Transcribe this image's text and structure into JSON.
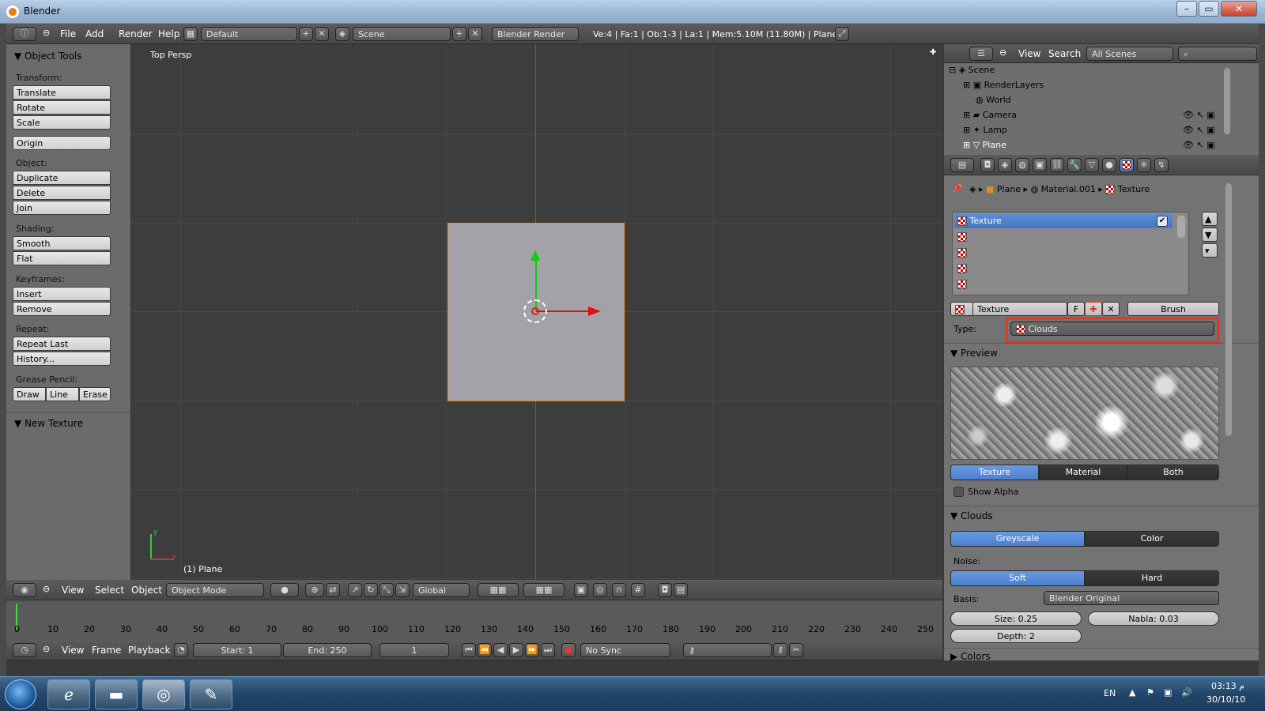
{
  "window": {
    "title": "Blender"
  },
  "topbar": {
    "menus": [
      "File",
      "Add",
      "Render",
      "Help"
    ],
    "layout": "Default",
    "scene": "Scene",
    "engine": "Blender Render",
    "stats": "Ve:4 | Fa:1 | Ob:1-3 | La:1 | Mem:5.10M (11.80M) | Plane"
  },
  "tools": {
    "title": "Object Tools",
    "transform_label": "Transform:",
    "translate": "Translate",
    "rotate": "Rotate",
    "scale": "Scale",
    "origin": "Origin",
    "object_label": "Object:",
    "duplicate": "Duplicate",
    "delete": "Delete",
    "join": "Join",
    "shading_label": "Shading:",
    "smooth": "Smooth",
    "flat": "Flat",
    "keyframes_label": "Keyframes:",
    "insert": "Insert",
    "remove": "Remove",
    "repeat_label": "Repeat:",
    "repeat_last": "Repeat Last",
    "history": "History...",
    "grease_label": "Grease Pencil:",
    "draw": "Draw",
    "line": "Line",
    "erase": "Erase",
    "new_texture": "New Texture"
  },
  "viewport": {
    "view_name": "Top Persp",
    "object_label": "(1) Plane",
    "axis_x": "x",
    "axis_y": "y"
  },
  "view_header": {
    "view": "View",
    "select": "Select",
    "object": "Object",
    "mode": "Object Mode",
    "orientation": "Global"
  },
  "timeline": {
    "ticks": [
      "0",
      "10",
      "20",
      "30",
      "40",
      "50",
      "60",
      "70",
      "80",
      "90",
      "100",
      "110",
      "120",
      "130",
      "140",
      "150",
      "160",
      "170",
      "180",
      "190",
      "200",
      "210",
      "220",
      "230",
      "240",
      "250"
    ],
    "view": "View",
    "frame": "Frame",
    "playback": "Playback",
    "start": "Start: 1",
    "end": "End: 250",
    "current": "1",
    "sync": "No Sync"
  },
  "outliner": {
    "view": "View",
    "search": "Search",
    "scenes": "All Scenes",
    "items": [
      "Scene",
      "RenderLayers",
      "World",
      "Camera",
      "Lamp",
      "Plane"
    ]
  },
  "properties": {
    "breadcrumb": [
      "Plane",
      "Material.001",
      "Texture"
    ],
    "slot_active": "Texture",
    "texture_name": "Texture",
    "fake_user": "F",
    "brush": "Brush",
    "type_label": "Type:",
    "type_value": "Clouds",
    "preview_title": "Preview",
    "preview_tabs": [
      "Texture",
      "Material",
      "Both"
    ],
    "show_alpha": "Show Alpha",
    "clouds_title": "Clouds",
    "greyscale": "Greyscale",
    "color": "Color",
    "noise_label": "Noise:",
    "soft": "Soft",
    "hard": "Hard",
    "basis_label": "Basis:",
    "basis_value": "Blender Original",
    "size": "Size: 0.25",
    "nabla": "Nabla: 0.03",
    "depth": "Depth: 2",
    "colors_title": "Colors"
  },
  "taskbar": {
    "lang": "EN",
    "time": "03:13 م",
    "date": "30/10/10"
  },
  "colors": {
    "accent": "#5b8ed4",
    "highlight": "#e2321f",
    "selection": "#f08a24"
  }
}
